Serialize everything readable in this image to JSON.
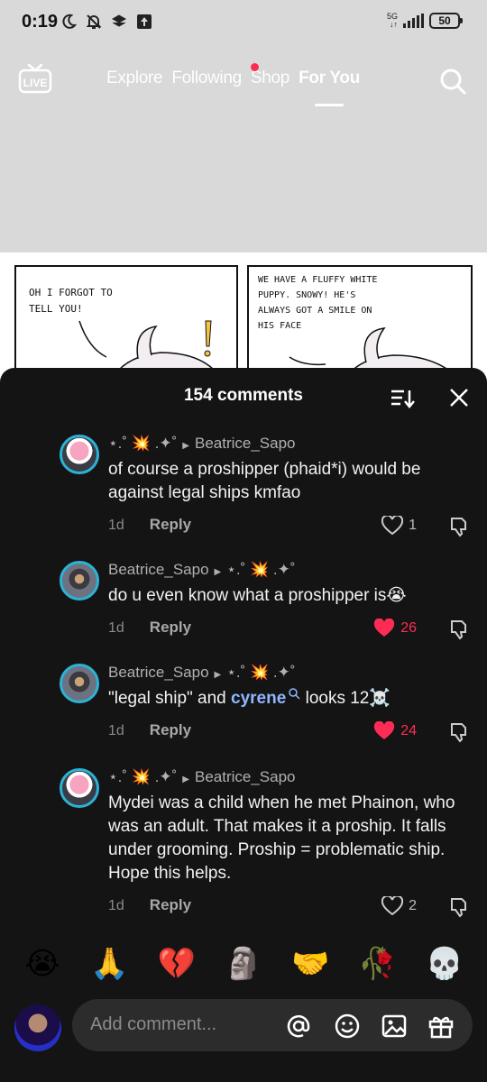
{
  "status_bar": {
    "time": "0:19",
    "network": "5G",
    "battery": "50"
  },
  "top_nav": {
    "tabs": [
      "Explore",
      "Following",
      "Shop",
      "For You"
    ],
    "active_tab": "For You",
    "live_label": "LIVE"
  },
  "comic": {
    "panel1_text": "OH I FORGOT TO TELL YOU!",
    "panel2_text": "WE HAVE A FLUFFY WHITE PUPPY. SNOWY! HE'S ALWAYS GOT A SMILE ON HIS FACE"
  },
  "comments_sheet": {
    "title": "154 comments",
    "comments": [
      {
        "user": "⋆.˚ 💥 .✦˚",
        "reply_to": "Beatrice_Sapo",
        "text": "of course a proshipper (phaid*i) would be against legal ships kmfao",
        "time": "1d",
        "reply_label": "Reply",
        "likes": "1",
        "liked": false
      },
      {
        "user": "Beatrice_Sapo",
        "reply_to": "⋆.˚ 💥 .✦˚",
        "text": "do u even know what a proshipper is😭",
        "time": "1d",
        "reply_label": "Reply",
        "likes": "26",
        "liked": true
      },
      {
        "user": "Beatrice_Sapo",
        "reply_to": "⋆.˚ 💥 .✦˚",
        "text_before": "\"legal ship\" and ",
        "mention": "cyrene",
        "text_after": " looks 12☠️",
        "time": "1d",
        "reply_label": "Reply",
        "likes": "24",
        "liked": true
      },
      {
        "user": "⋆.˚ 💥 .✦˚",
        "reply_to": "Beatrice_Sapo",
        "text": "Mydei was a child when he met Phainon, who was an adult. That makes it a proship. It falls under grooming. Proship = problematic ship. Hope this helps.",
        "time": "1d",
        "reply_label": "Reply",
        "likes": "2",
        "liked": false
      }
    ]
  },
  "emoji_bar": [
    "😭",
    "🙏",
    "💔",
    "🗿",
    "🤝",
    "🥀",
    "💀"
  ],
  "comment_input": {
    "placeholder": "Add comment..."
  },
  "colors": {
    "accent_red": "#fe2c55",
    "avatar_ring": "#2bb3d6",
    "sheet_bg": "#141414",
    "mention": "#8fb6ff"
  }
}
